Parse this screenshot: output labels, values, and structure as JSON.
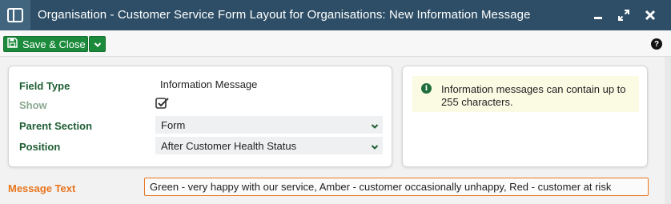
{
  "window": {
    "title": "Organisation - Customer Service Form Layout for Organisations: New Information Message",
    "app_icon": "layout-icon",
    "controls": [
      "minimize-icon",
      "maximize-icon",
      "close-icon"
    ]
  },
  "toolbar": {
    "save_close_label": "Save & Close",
    "save_icon": "save-icon",
    "dropdown_icon": "chevron-down-icon",
    "help_label": "?"
  },
  "form": {
    "field_type": {
      "label": "Field Type",
      "value": "Information Message"
    },
    "show": {
      "label": "Show",
      "checked": true
    },
    "parent_section": {
      "label": "Parent Section",
      "value": "Form"
    },
    "position": {
      "label": "Position",
      "value": "After Customer Health Status"
    }
  },
  "info": {
    "icon": "info-icon",
    "text": "Information messages can contain up to 255 characters."
  },
  "message": {
    "label": "Message Text",
    "value": "Green - very happy with our service, Amber - customer occasionally unhappy, Red - customer at risk"
  },
  "colors": {
    "titlebar": "#2d4e66",
    "primary_button": "#1b8a3b",
    "field_label": "#1e5e33",
    "required_accent": "#e8761f",
    "info_background": "#fbfbe4"
  }
}
